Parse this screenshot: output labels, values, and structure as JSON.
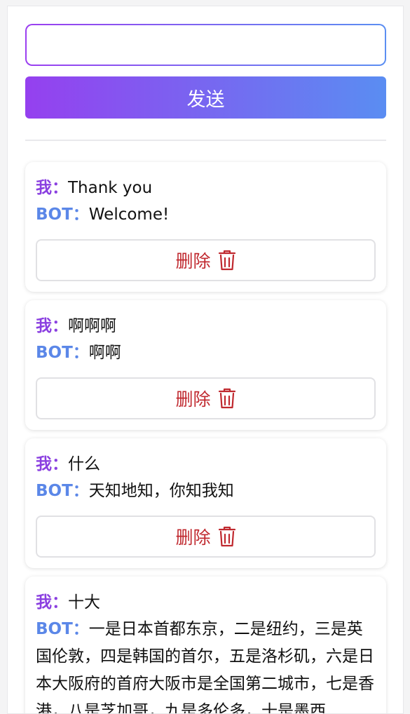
{
  "composer": {
    "input_value": "",
    "input_placeholder": "",
    "send_label": "发送"
  },
  "labels": {
    "me": "我：",
    "bot": "BOT："
  },
  "delete_label": "删除",
  "colors": {
    "accent_start": "#9540ef",
    "accent_end": "#5a8df2",
    "me_label": "#8a3fe0",
    "bot_label": "#5b87e8",
    "delete_text": "#c0292f"
  },
  "icons": {
    "delete": "trash-icon"
  },
  "messages": [
    {
      "me": "Thank you",
      "bot": "Welcome!"
    },
    {
      "me": "啊啊啊",
      "bot": "啊啊"
    },
    {
      "me": "什么",
      "bot": "天知地知，你知我知"
    },
    {
      "me": "十大",
      "bot": "一是日本首都东京，二是纽约，三是英国伦敦，四是韩国的首尔，五是洛杉矶，六是日本大阪府的首府大阪市是全国第二城市，七是香港，八是芝加哥，九是多伦多，十是墨西"
    }
  ]
}
